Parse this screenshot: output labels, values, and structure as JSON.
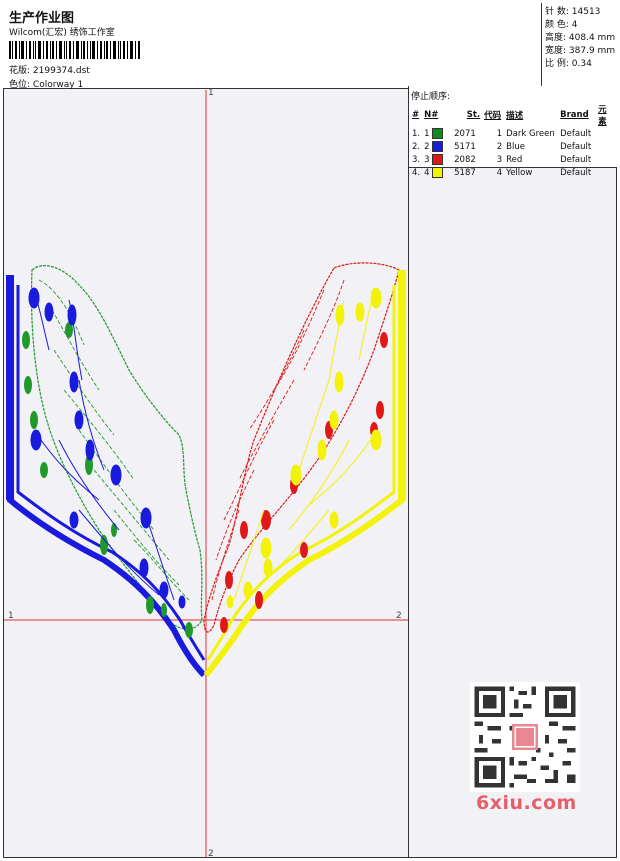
{
  "header": {
    "title": "生产作业图",
    "subtitle": "Wilcom(汇宏) 绣饰工作室",
    "design_label": "花版:",
    "design_value": "2199374.dst",
    "colorway_label": "色位:",
    "colorway_value": "Colorway 1"
  },
  "stats": [
    {
      "label": "针 数:",
      "value": "14513"
    },
    {
      "label": "颜 色:",
      "value": "4"
    },
    {
      "label": "高度:",
      "value": "408.4 mm"
    },
    {
      "label": "宽度:",
      "value": "387.9 mm"
    },
    {
      "label": "比 例:",
      "value": "0.34"
    }
  ],
  "legend": {
    "heading": "停止顺序:",
    "columns": [
      "#",
      "N#",
      "St.",
      "代码",
      "描述",
      "Brand",
      "元素"
    ],
    "rows": [
      {
        "seq": "1.",
        "num": "1",
        "color": "#0f8a1c",
        "stitch": "2071",
        "code": "1",
        "desc": "Dark Green",
        "brand": "Default"
      },
      {
        "seq": "2.",
        "num": "2",
        "color": "#1a1adc",
        "stitch": "5171",
        "code": "2",
        "desc": "Blue",
        "brand": "Default"
      },
      {
        "seq": "3.",
        "num": "3",
        "color": "#e01818",
        "stitch": "2082",
        "code": "3",
        "desc": "Red",
        "brand": "Default"
      },
      {
        "seq": "4.",
        "num": "4",
        "color": "#f2f20a",
        "stitch": "5187",
        "code": "4",
        "desc": "Yellow",
        "brand": "Default"
      }
    ]
  },
  "axes": {
    "top": "1",
    "bottom": "2",
    "left": "1",
    "right": "2"
  },
  "watermark": "6xiu.com"
}
